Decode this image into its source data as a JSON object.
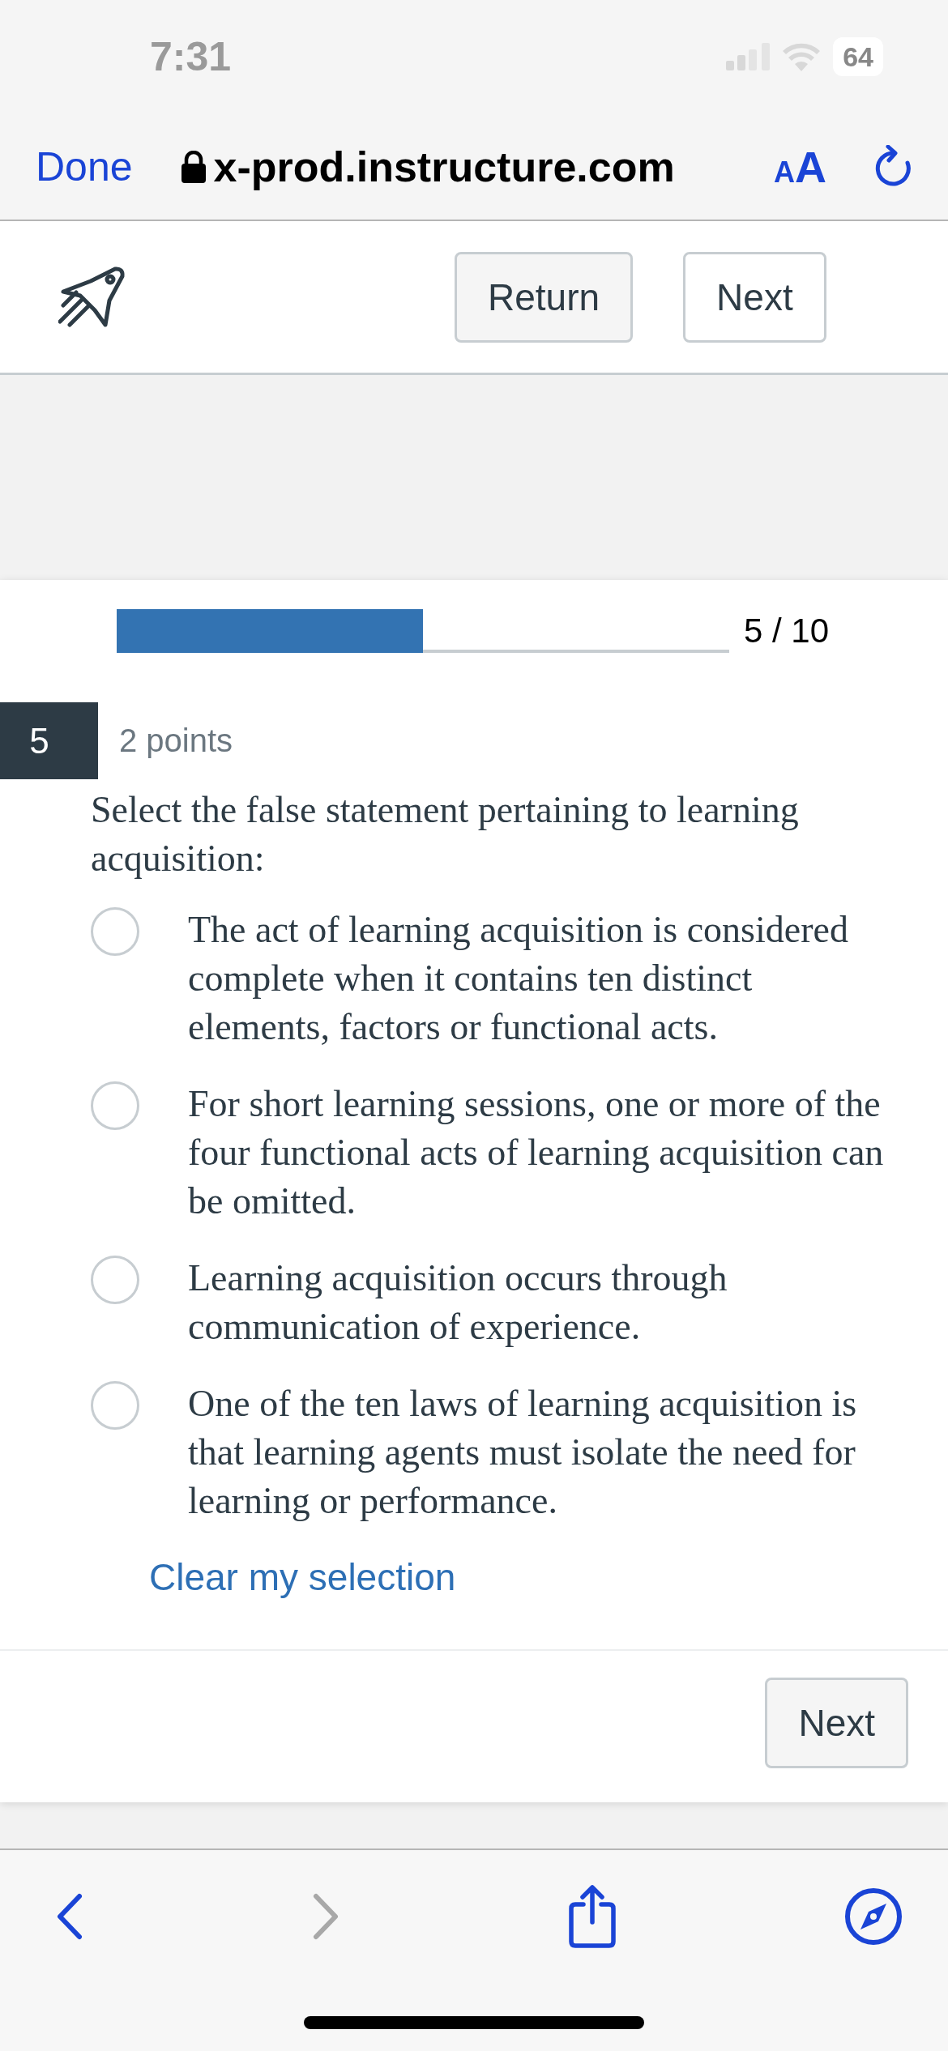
{
  "status_bar": {
    "time": "7:31",
    "battery": "64"
  },
  "browser": {
    "done": "Done",
    "url": "x-prod.instructure.com",
    "text_size": "AA"
  },
  "header": {
    "buttons": [
      {
        "label": "Return",
        "kind": "filled"
      },
      {
        "label": "Next",
        "kind": "outline"
      }
    ]
  },
  "progress": {
    "level": 0.5,
    "reading": "5 / 10"
  },
  "question": {
    "number": "5",
    "points": "2 points",
    "text": "Select the false statement pertaining to learning acquisition:",
    "options": [
      {
        "text": "The act of learning acquisition is considered complete when it contains ten distinct elements, factors or functional acts.",
        "selected": false
      },
      {
        "text": "For short learning sessions, one or more of the four functional acts of learning acquisition can be omitted.",
        "selected": false
      },
      {
        "text": "Learning acquisition occurs through communication of experience.",
        "selected": false
      },
      {
        "text": "One of the ten laws of learning acquisition is that learning agents must isolate the need for learning or performance.",
        "selected": false
      }
    ],
    "clear": "Clear my selection"
  },
  "footer": {
    "button": "Next"
  },
  "toolbar": {
    "back": {
      "disabled": false
    },
    "forward": {
      "disabled": true
    }
  }
}
